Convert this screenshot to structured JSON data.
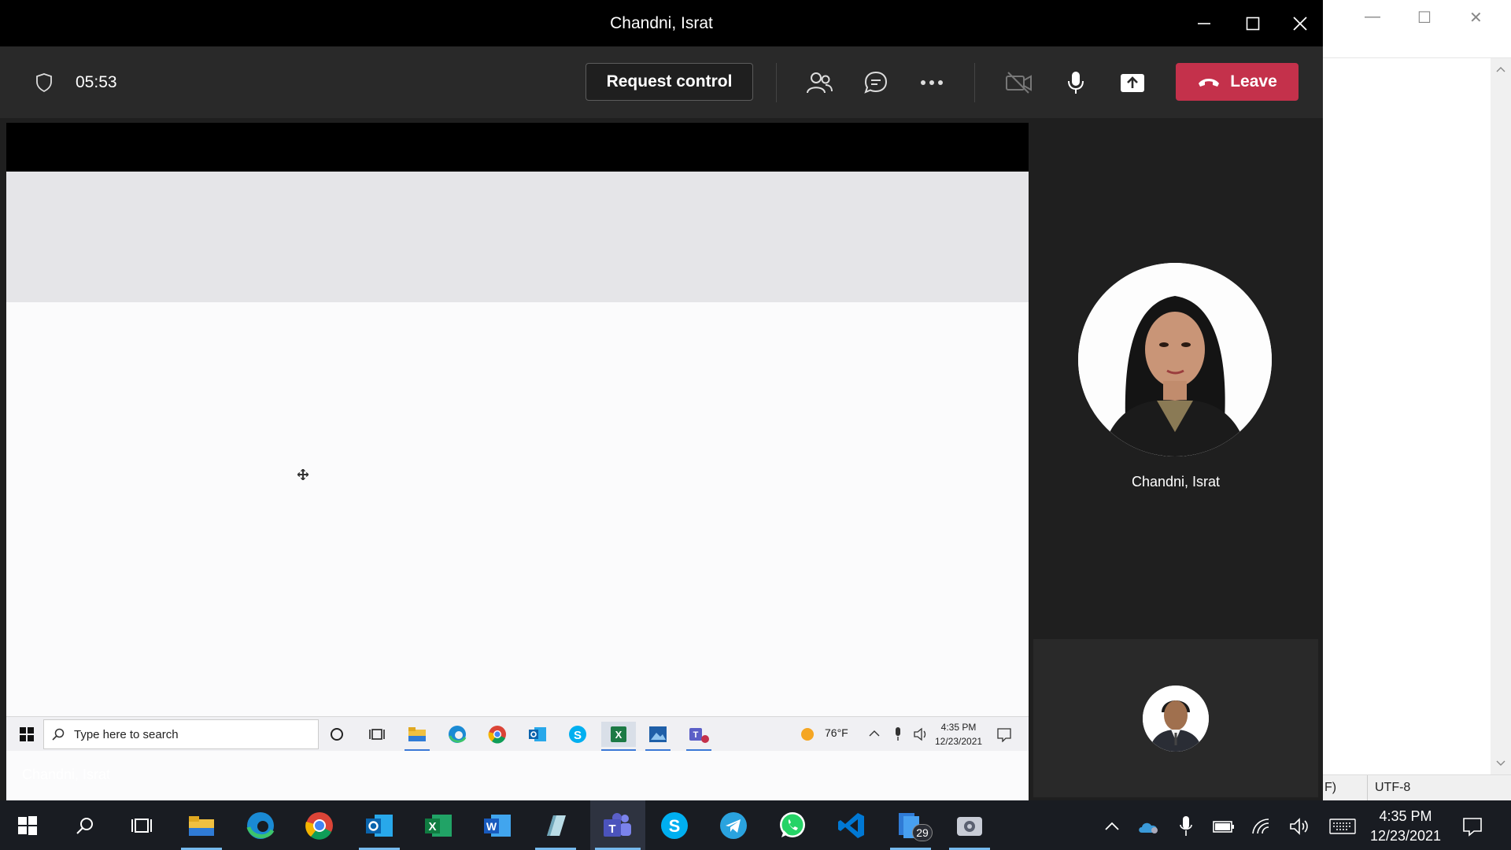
{
  "window": {
    "title": "Chandni, Israt"
  },
  "toolbar": {
    "timer": "05:53",
    "request_control_label": "Request control",
    "leave_label": "Leave"
  },
  "shared_screen": {
    "presenter_name": "Chandni, Israt",
    "taskbar": {
      "search_placeholder": "Type here to search",
      "weather": "76°F",
      "time": "4:35 PM",
      "date": "12/23/2021"
    }
  },
  "participants": [
    {
      "name": "Chandni, Israt"
    }
  ],
  "notepad": {
    "status_left": "F)",
    "encoding": "UTF-8"
  },
  "taskbar": {
    "time": "4:35 PM",
    "date": "12/23/2021",
    "badge_count": "29",
    "apps": [
      "start-icon",
      "search-icon",
      "task-view-icon",
      "file-explorer-icon",
      "edge-icon",
      "chrome-icon",
      "outlook-icon",
      "excel-icon",
      "word-icon",
      "notepad-icon",
      "teams-icon",
      "skype-icon",
      "telegram-icon",
      "whatsapp-icon",
      "vscode-icon",
      "files-icon",
      "unknown-app-icon"
    ]
  },
  "colors": {
    "leave": "#c4314b",
    "teams_bg": "#1f1f1f",
    "toolbar_bg": "#292929",
    "taskbar_bg": "#191c22"
  }
}
